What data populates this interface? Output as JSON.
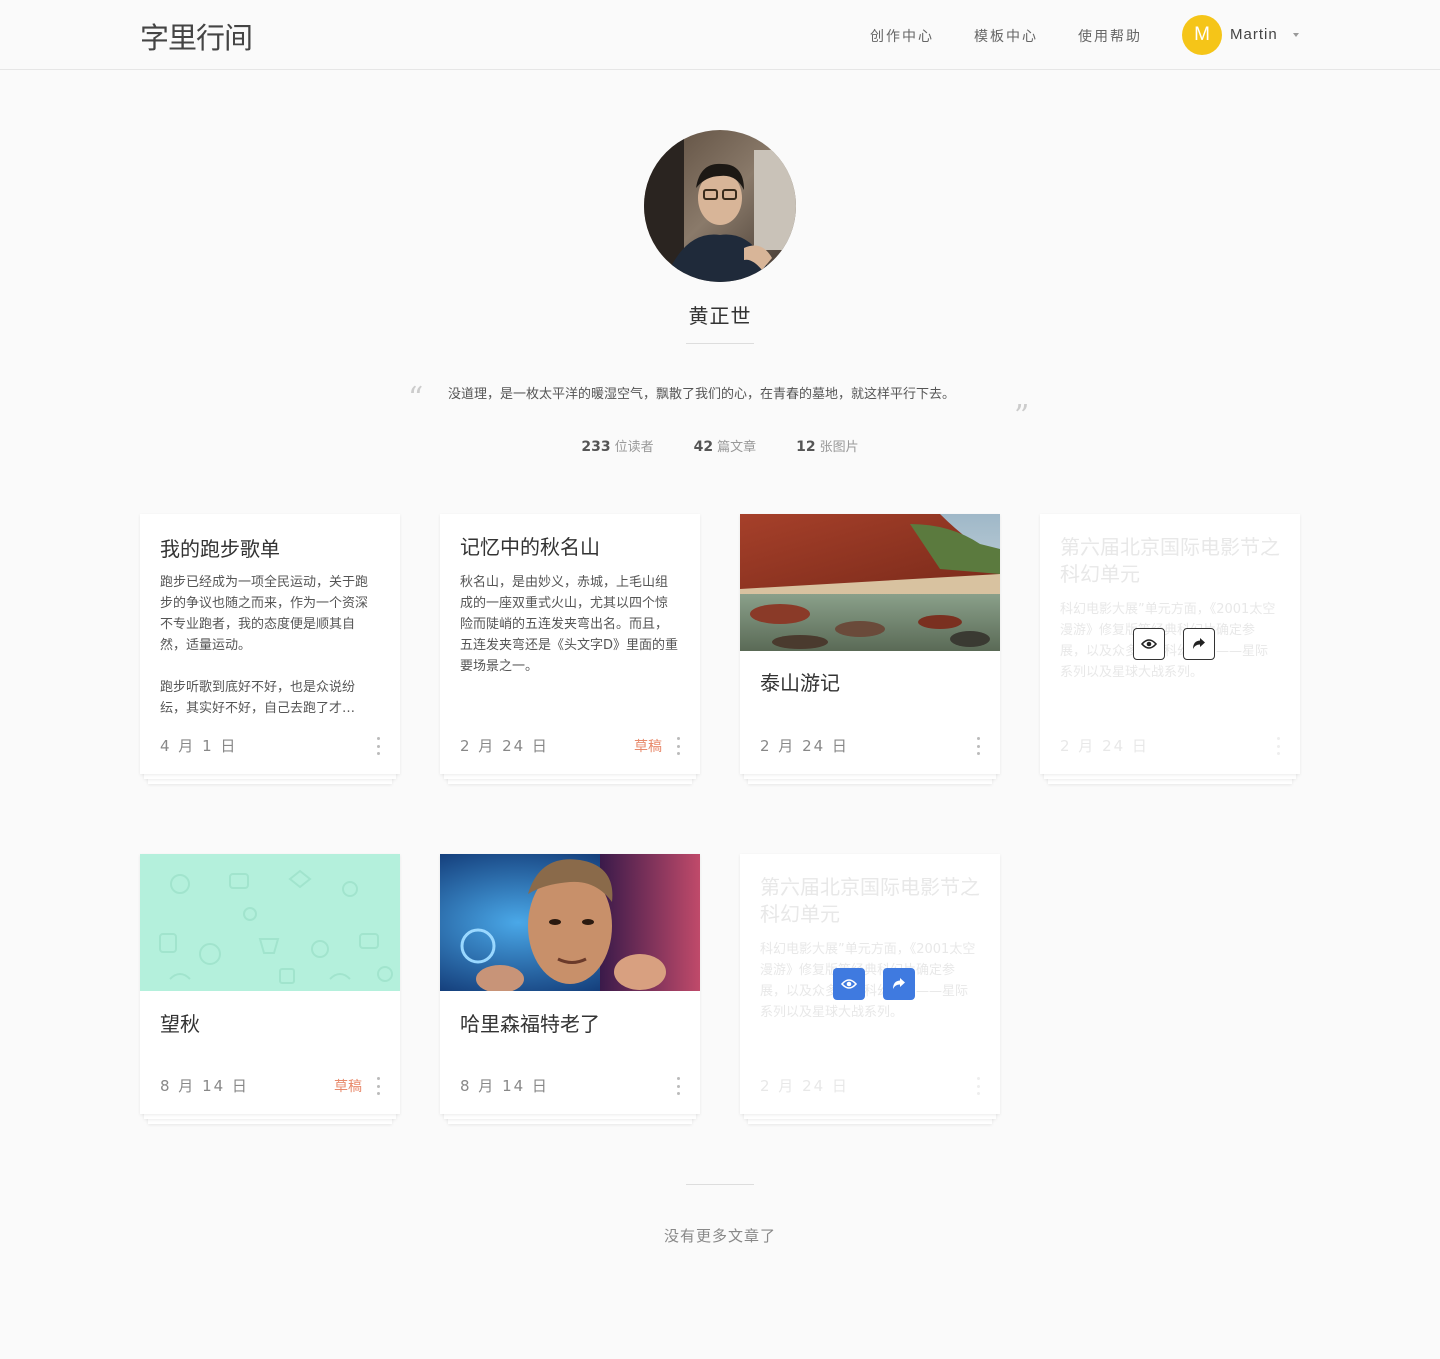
{
  "header": {
    "logo": "字里行间",
    "nav": [
      "创作中心",
      "模板中心",
      "使用帮助"
    ],
    "user": {
      "initial": "M",
      "name": "Martin",
      "avatar_color": "#f5c518"
    }
  },
  "profile": {
    "name": "黄正世",
    "bio": "没道理，是一枚太平洋的暖湿空气，飘散了我们的心，在青春的墓地，就这样平行下去。",
    "quote_open": "“",
    "quote_close": "”",
    "stats": [
      {
        "value": "233",
        "label": "位读者"
      },
      {
        "value": "42",
        "label": "篇文章"
      },
      {
        "value": "12",
        "label": "张图片"
      }
    ]
  },
  "cards": [
    {
      "title": "我的跑步歌单",
      "excerpt_1": "跑步已经成为一项全民运动，关于跑步的争议也随之而来，作为一个资深不专业跑者，我的态度便是顺其自然，适量运动。",
      "excerpt_2": "跑步听歌到底好不好，也是众说纷纭，其实好不好，自己去跑了才…",
      "date": "4 月 1 日"
    },
    {
      "title": "记忆中的秋名山",
      "excerpt": "秋名山，是由妙义，赤城，上毛山组成的一座双重式火山，尤其以四个惊险而陡峭的五连发夹弯出名。而且，五连发夹弯还是《头文字D》里面的重要场景之一。",
      "date": "2 月 24 日",
      "draft": "草稿"
    },
    {
      "title": "泰山游记",
      "date": "2 月 24 日",
      "image": "landscape-photo"
    },
    {
      "title": "第六届北京国际电影节之科幻单元",
      "excerpt": "科幻电影大展”单元方面，《2001太空漫游》修复版等经典科幻片确定参展，以及众多人的科幻启蒙——星际系列以及星球大战系列。",
      "date": "2 月 24 日",
      "state": "faded",
      "buttons": [
        "eye-icon",
        "share-icon"
      ]
    },
    {
      "title": "望秋",
      "date": "8 月 14 日",
      "draft": "草稿",
      "image": "mint-pattern",
      "image_color": "#b4f0dc"
    },
    {
      "title": "哈里森福特老了",
      "date": "8 月 14 日",
      "image": "movie-poster"
    },
    {
      "title": "第六届北京国际电影节之科幻单元",
      "excerpt": "科幻电影大展”单元方面，《2001太空漫游》修复版等经典科幻片确定参展，以及众多人的科幻启蒙——星际系列以及星球大战系列。",
      "date": "2 月 24 日",
      "state": "faded",
      "buttons": [
        "eye-icon",
        "share-icon"
      ],
      "button_color": "#3f7ae0"
    }
  ],
  "footer": {
    "text": "没有更多文章了"
  }
}
